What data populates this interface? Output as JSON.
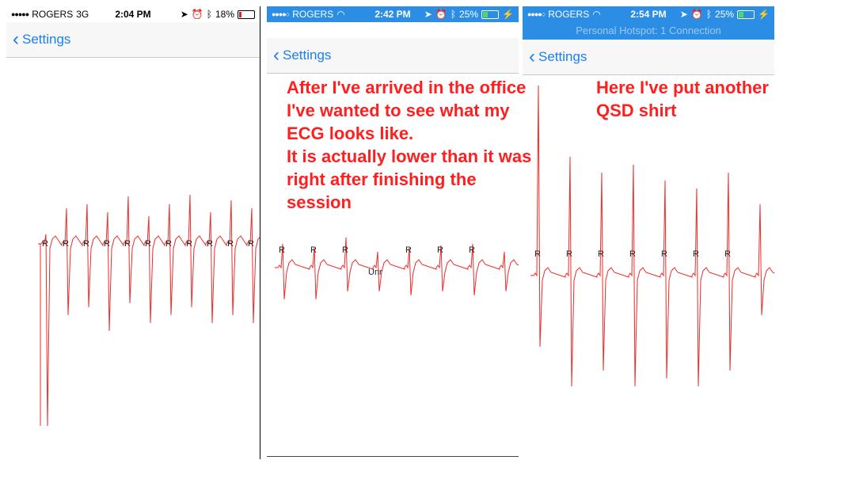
{
  "accent_color": "#1a7ff0",
  "trace_color": "#ee2a2a",
  "screens": [
    {
      "carrier": "ROGERS",
      "network": "3G",
      "time": "2:04 PM",
      "battery": "18%",
      "back_label": "Settings",
      "r_label": "R"
    },
    {
      "carrier": "ROGERS",
      "time": "2:42 PM",
      "battery": "25%",
      "back_label": "Settings",
      "r_label": "R",
      "unr_label": "Unr"
    },
    {
      "carrier": "ROGERS",
      "time": "2:54 PM",
      "battery": "25%",
      "hotspot": "Personal Hotspot: 1 Connection",
      "back_label": "Settings",
      "r_label": "R"
    }
  ],
  "annotations": {
    "note1": "After I've arrived in the office\nI've wanted to see what my\nECG looks like.\nIt is actually lower than it was\nright after finishing the\nsession",
    "note2": "Here I've put another\nQSD shirt"
  }
}
